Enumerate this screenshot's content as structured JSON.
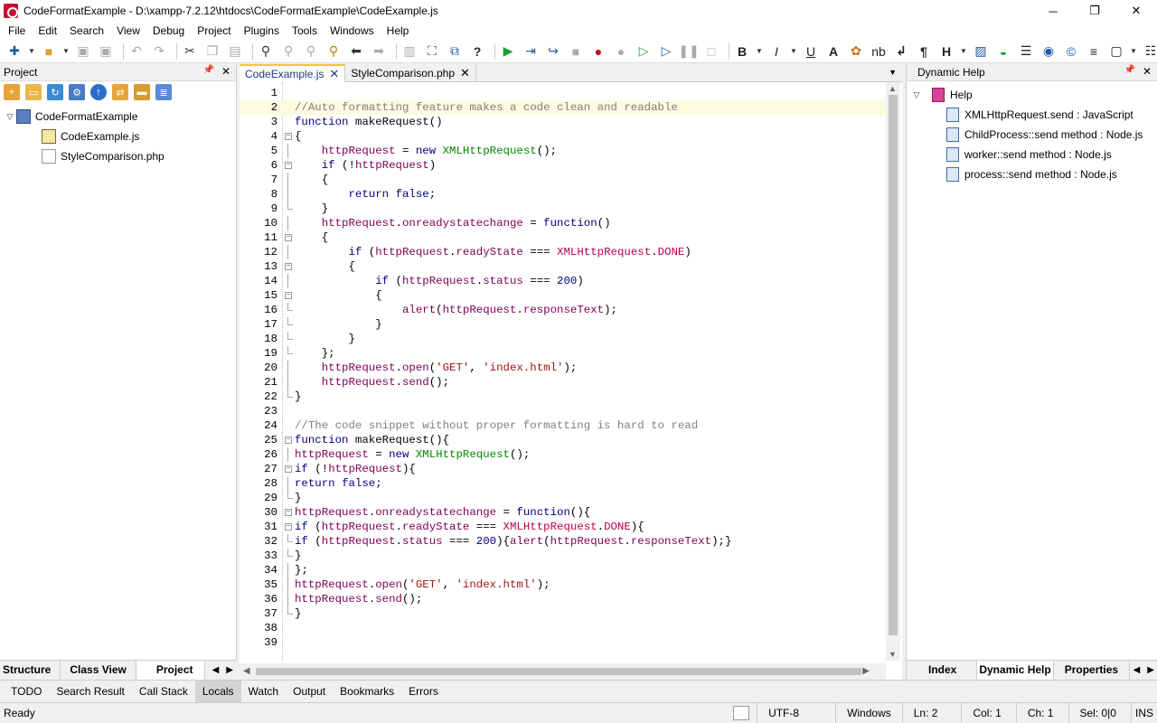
{
  "window": {
    "title": "CodeFormatExample - D:\\xampp-7.2.12\\htdocs\\CodeFormatExample\\CodeExample.js",
    "min": "─",
    "max": "❐",
    "close": "✕"
  },
  "menu": [
    "File",
    "Edit",
    "Search",
    "View",
    "Debug",
    "Project",
    "Plugins",
    "Tools",
    "Windows",
    "Help"
  ],
  "project_panel": {
    "title": "Project",
    "pin": "📌",
    "close": "✕",
    "tree": [
      {
        "label": "CodeFormatExample",
        "expand": "▽"
      },
      {
        "label": "CodeExample.js"
      },
      {
        "label": "StyleComparison.php"
      }
    ],
    "tabs": [
      "Structure",
      "Class View",
      "Project"
    ]
  },
  "editor": {
    "tabs": [
      {
        "label": "CodeExample.js",
        "close": "✕"
      },
      {
        "label": "StyleComparison.php",
        "close": "✕"
      }
    ],
    "dropdown": "▼",
    "current_line": 2
  },
  "code_lines": [
    "",
    "//Auto formatting feature makes a code clean and readable",
    "function makeRequest()",
    "{",
    "    httpRequest = new XMLHttpRequest();",
    "    if (!httpRequest)",
    "    {",
    "        return false;",
    "    }",
    "    httpRequest.onreadystatechange = function()",
    "    {",
    "        if (httpRequest.readyState === XMLHttpRequest.DONE)",
    "        {",
    "            if (httpRequest.status === 200)",
    "            {",
    "                alert(httpRequest.responseText);",
    "            }",
    "        }",
    "    };",
    "    httpRequest.open('GET', 'index.html');",
    "    httpRequest.send();",
    "}",
    "",
    "//The code snippet without proper formatting is hard to read",
    "function makeRequest(){",
    "httpRequest = new XMLHttpRequest();",
    "if (!httpRequest){",
    "return false;",
    "}",
    "httpRequest.onreadystatechange = function(){",
    "if (httpRequest.readyState === XMLHttpRequest.DONE){",
    "if (httpRequest.status === 200){alert(httpRequest.responseText);}",
    "}",
    "};",
    "httpRequest.open('GET', 'index.html');",
    "httpRequest.send();",
    "}",
    "",
    ""
  ],
  "help_panel": {
    "title": "Dynamic Help",
    "pin": "📌",
    "close": "✕",
    "root": "Help",
    "items": [
      "XMLHttpRequest.send : JavaScript",
      "ChildProcess::send method : Node.js",
      "worker::send method : Node.js",
      "process::send method : Node.js"
    ],
    "tabs": [
      "Index",
      "Dynamic Help",
      "Properties"
    ]
  },
  "bottom_tabs": [
    "TODO",
    "Search Result",
    "Call Stack",
    "Locals",
    "Watch",
    "Output",
    "Bookmarks",
    "Errors"
  ],
  "status": {
    "ready": "Ready",
    "encoding": "UTF-8",
    "line_ending": "Windows",
    "line": "Ln: 2",
    "col": "Col: 1",
    "ch": "Ch: 1",
    "sel": "Sel: 0|0",
    "mode": "INS"
  }
}
